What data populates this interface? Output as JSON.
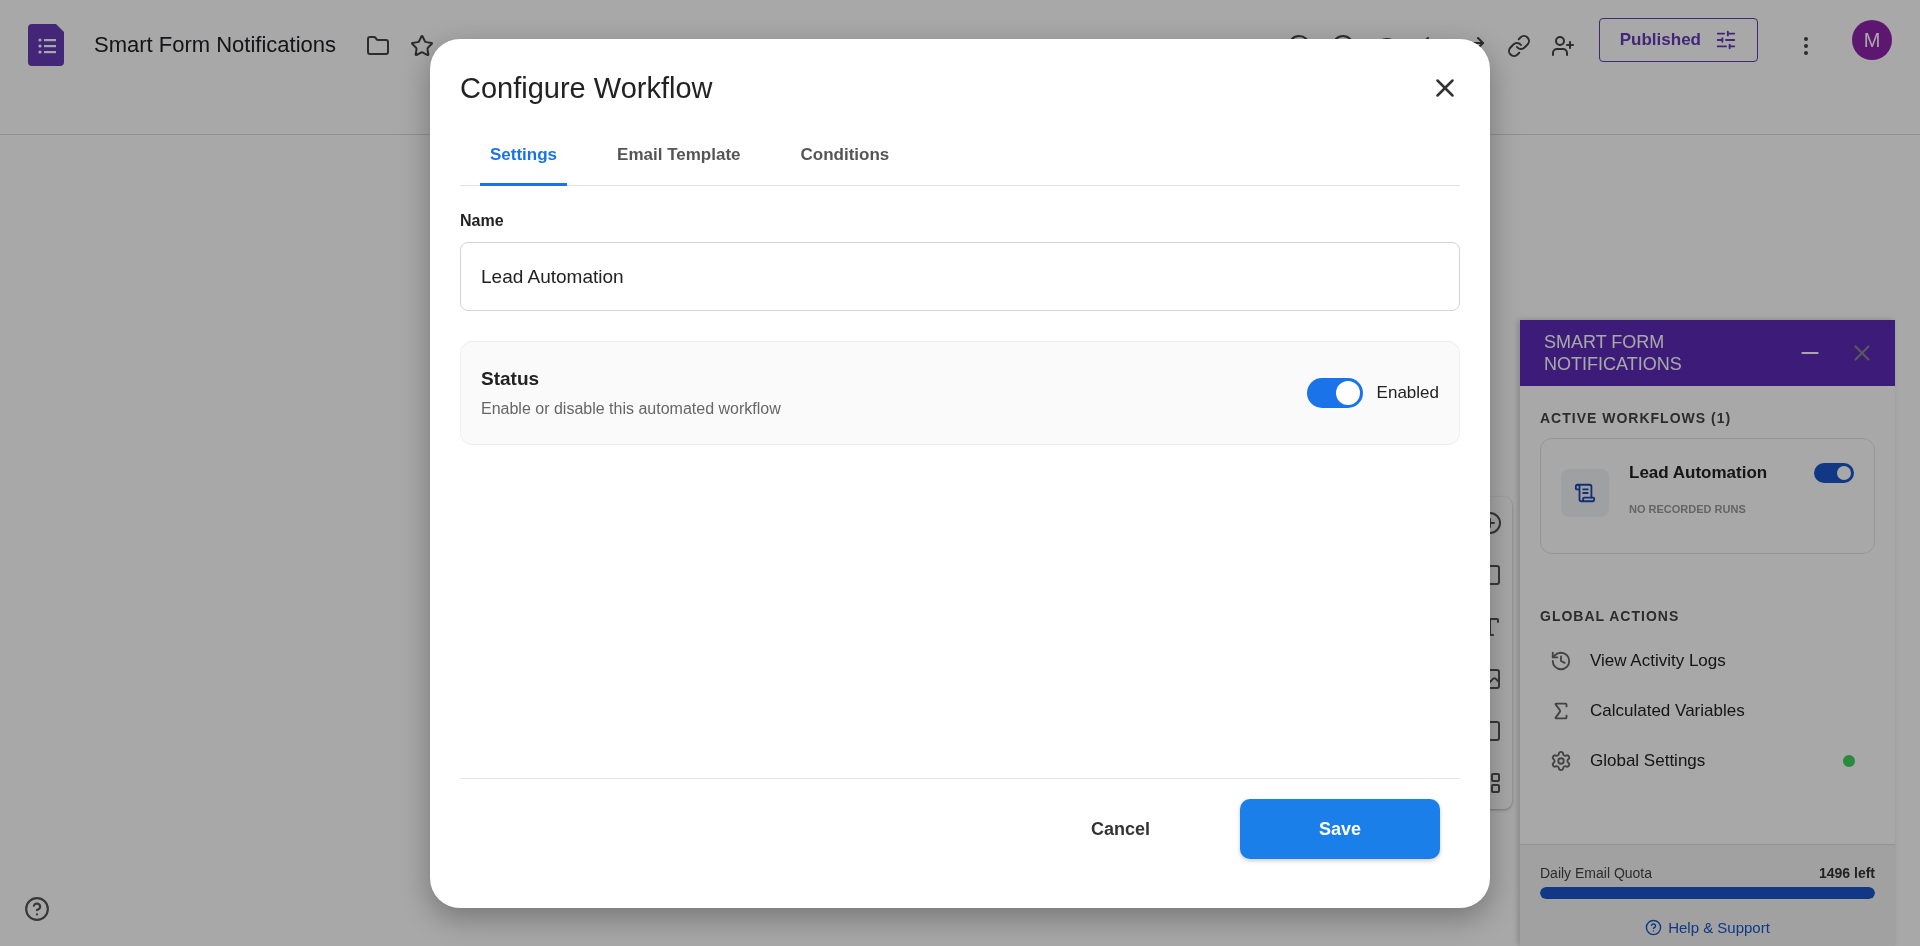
{
  "app": {
    "title": "Smart Form Notifications",
    "publish_button": "Published",
    "avatar": "M"
  },
  "dialog": {
    "title": "Configure Workflow",
    "tabs": [
      {
        "label": "Settings",
        "selected": true
      },
      {
        "label": "Email Template",
        "selected": false
      },
      {
        "label": "Conditions",
        "selected": false
      }
    ],
    "name_label": "Name",
    "name_value": "Lead Automation",
    "status": {
      "title": "Status",
      "description": "Enable or disable this automated workflow",
      "on": true,
      "label": "Enabled"
    },
    "cancel_button": "Cancel",
    "save_button": "Save"
  },
  "sidebar": {
    "title": "SMART FORM NOTIFICATIONS",
    "section_title": "ACTIVE WORKFLOWS (1)",
    "workflows": [
      {
        "name": "Lead Automation",
        "subtitle": "NO RECORDED RUNS",
        "on": true
      }
    ],
    "actions_title": "GLOBAL ACTIONS",
    "actions": [
      {
        "label": "View Activity Logs",
        "kind": "history"
      },
      {
        "label": "Calculated Variables",
        "kind": "sigma"
      },
      {
        "label": "Global Settings",
        "kind": "gear",
        "color": "#2a8a3e"
      }
    ],
    "quota": {
      "label": "Daily Email Quota",
      "reading": "1496 left",
      "level": 1
    },
    "help": "Help & Support"
  }
}
